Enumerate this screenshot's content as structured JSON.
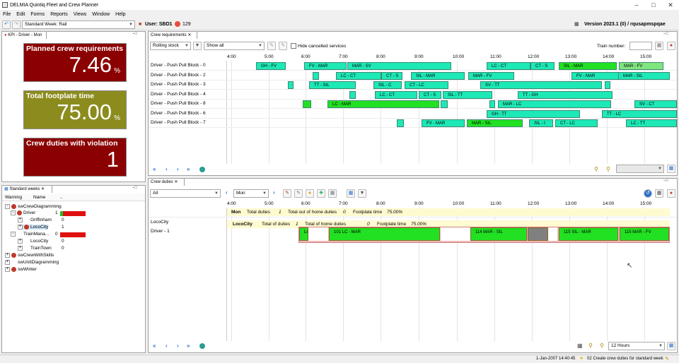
{
  "window": {
    "title": "DELMIA Quintiq Fleet and Crew Planner"
  },
  "menu": [
    "File",
    "Edit",
    "Forms",
    "Reports",
    "Views",
    "Window",
    "Help"
  ],
  "toolbar": {
    "dataset": "Standard Week: Rail",
    "user_label": "User: SBD1",
    "count": "129",
    "version": "Version 2023.1 (0) / rqusapmspqae"
  },
  "kpi_panel": {
    "tab": "KPI - Driver - Mon",
    "tiles": [
      {
        "label": "Planned crew requirements",
        "value": "7.46",
        "unit": "%",
        "color": "#8b0000"
      },
      {
        "label": "Total footplate time",
        "value": "75.00",
        "unit": "%",
        "color": "#8c8c1e"
      },
      {
        "label": "Crew duties with violation",
        "value": "1",
        "unit": "",
        "color": "#8b0000"
      }
    ]
  },
  "weeks_panel": {
    "tab": "Standard weeks",
    "columns": [
      "Warning",
      "Name",
      ".."
    ],
    "tree": [
      {
        "label": "swCrewDiagramming",
        "count": ""
      },
      {
        "label": "Driver",
        "count": "1"
      },
      {
        "label": "Griffinham",
        "count": "0"
      },
      {
        "label": "LocoCity",
        "count": "1"
      },
      {
        "label": "TrainMana...",
        "count": "0"
      },
      {
        "label": "LocoCity",
        "count": "0"
      },
      {
        "label": "TrainTown",
        "count": "0"
      },
      {
        "label": "swCrewWithSkills",
        "count": ""
      },
      {
        "label": "swUnitDiagramming",
        "count": ""
      },
      {
        "label": "swWinter",
        "count": ""
      }
    ]
  },
  "crew_req": {
    "tab": "Crew requirements",
    "filter1": "Rolling stock",
    "filter2": "Show all",
    "hide_cancelled": "Hide cancelled services",
    "train_number_label": "Train number:",
    "hours": [
      "4:00",
      "5:00",
      "6:00",
      "7:00",
      "8:00",
      "9:00",
      "10:00",
      "11:00",
      "12:00",
      "13:00",
      "14:00",
      "15:00"
    ],
    "rows": [
      {
        "name": "Driver - Push Pull Block - 0",
        "bars": [
          {
            "label": "GH - FV",
            "color": "#1de9b6"
          },
          {
            "label": "FV - MAR",
            "color": "#1de9b6"
          },
          {
            "label": "MAR - SV",
            "color": "#1de9b6"
          },
          {
            "label": "LC - CT",
            "color": "#1de9b6"
          },
          {
            "label": "CT - S",
            "color": "#1de9b6"
          },
          {
            "label": "SIL - MAR",
            "color": "#22e022"
          },
          {
            "label": "MAR - FV",
            "color": "#7fe67f"
          }
        ]
      },
      {
        "name": "Driver - Push Pull Block - 2",
        "bars": [
          {
            "label": "",
            "color": "#1de9b6"
          },
          {
            "label": "LC - CT",
            "color": "#1de9b6"
          },
          {
            "label": "CT - S",
            "color": "#1de9b6"
          },
          {
            "label": "SIL - MAR",
            "color": "#1de9b6"
          },
          {
            "label": "MAR - FV",
            "color": "#1de9b6"
          },
          {
            "label": "FV - MAR",
            "color": "#1de9b6"
          },
          {
            "label": "MAR - SIL",
            "color": "#1de9b6"
          }
        ]
      },
      {
        "name": "Driver - Push Pull Block - 3",
        "bars": [
          {
            "label": "",
            "color": "#1de9b6"
          },
          {
            "label": "TT - SIL",
            "color": "#1de9b6"
          },
          {
            "label": "SIL - C",
            "color": "#1de9b6"
          },
          {
            "label": "CT - LC",
            "color": "#1de9b6"
          },
          {
            "label": "SV - TT",
            "color": "#1de9b6"
          },
          {
            "label": "TT - SV",
            "color": "#1de9b6"
          }
        ]
      },
      {
        "name": "Driver - Push Pull Block - 4",
        "bars": [
          {
            "label": "",
            "color": "#1de9b6"
          },
          {
            "label": "LC - CT",
            "color": "#1de9b6"
          },
          {
            "label": "CT - S",
            "color": "#1de9b6"
          },
          {
            "label": "SIL - TT",
            "color": "#1de9b6"
          },
          {
            "label": "TT - GH",
            "color": "#1de9b6"
          }
        ]
      },
      {
        "name": "Driver - Push Pull Block - 8",
        "bars": [
          {
            "label": "",
            "color": "#22e022"
          },
          {
            "label": "LC - MAR",
            "color": "#22e022"
          },
          {
            "label": "",
            "color": "#1de9b6"
          },
          {
            "label": "",
            "color": "#1de9b6"
          },
          {
            "label": "MAR - LC",
            "color": "#1de9b6"
          },
          {
            "label": "SV - CT",
            "color": "#1de9b6"
          }
        ]
      },
      {
        "name": "Driver - Push Pull Block - 6",
        "bars": [
          {
            "label": "GH - TT",
            "color": "#1de9b6"
          },
          {
            "label": "TT - LC",
            "color": "#1de9b6"
          }
        ]
      },
      {
        "name": "Driver - Push Pull Block - 7",
        "bars": [
          {
            "label": "",
            "color": "#1de9b6"
          },
          {
            "label": "FV - MAR",
            "color": "#1de9b6"
          },
          {
            "label": "MAR - SIL",
            "color": "#22e022"
          },
          {
            "label": "SIL - I",
            "color": "#1de9b6"
          },
          {
            "label": "CT - LC",
            "color": "#1de9b6"
          },
          {
            "label": "LC - TT",
            "color": "#1de9b6"
          }
        ]
      }
    ]
  },
  "crew_duties": {
    "tab": "Crew duties",
    "filter": "All",
    "day": "Mon",
    "hours": [
      "4:00",
      "5:00",
      "6:00",
      "7:00",
      "8:00",
      "9:00",
      "10:00",
      "11:00",
      "12:00",
      "13:00",
      "14:00",
      "15:00"
    ],
    "day_summary": {
      "day": "Mon",
      "total_duties": "Total duties",
      "total_duties_val": "1",
      "out_home": "Total out of home duties",
      "out_home_val": "0",
      "footplate": "Footplate time",
      "footplate_val": "75.00%"
    },
    "depot_summary": {
      "depot": "LocoCity",
      "total_duties": "Total of duties",
      "total_duties_val": "1",
      "out_home": "Total of home duties",
      "out_home_val": "0",
      "footplate": "Footplate time",
      "footplate_val": "75.00%"
    },
    "depot_label": "LocoCity",
    "driver_label": "Driver - 1",
    "bars": [
      {
        "label": "LC",
        "color": "#22e022"
      },
      {
        "label": "101 LC - MAR",
        "color": "#22e022"
      },
      {
        "label": "114 MAR - SIL",
        "color": "#22e022"
      },
      {
        "label": "",
        "color": "#808080"
      },
      {
        "label": "115 SIL - MAR",
        "color": "#22e022"
      },
      {
        "label": "115 MAR - FV",
        "color": "#22e022"
      }
    ],
    "zoom": "12 Hours"
  },
  "statusbar": {
    "datetime": "1-Jan-2007 14:40:45",
    "message": "02 Create crew duties for standard week"
  }
}
